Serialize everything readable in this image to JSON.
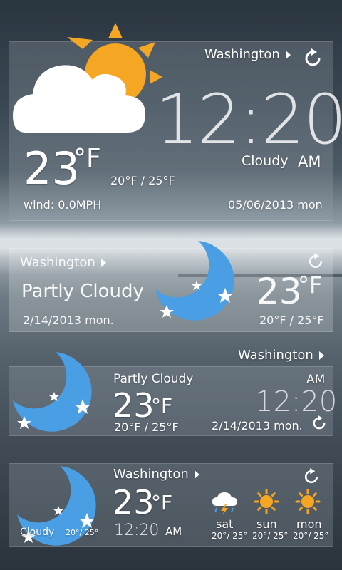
{
  "widget1": {
    "city": "Washington",
    "time": "12:20",
    "ampm": "AM",
    "condition": "Cloudy",
    "temp": "23",
    "unit": "°F",
    "range": "20°F / 25°F",
    "wind": "wind: 0.0MPH",
    "date": "05/06/2013 mon",
    "icon": "sun-behind-cloud-icon"
  },
  "widget2": {
    "city": "Washington",
    "condition": "Partly Cloudy",
    "date": "2/14/2013 mon.",
    "temp": "23",
    "unit": "°F",
    "range": "20°F / 25°F",
    "icon": "moon-stars-icon"
  },
  "widget3": {
    "city": "Washington",
    "condition": "Partly Cloudy",
    "temp": "23",
    "unit": "°F",
    "range": "20°F / 25°F",
    "ampm": "AM",
    "time": "12:20",
    "date": "2/14/2013 mon.",
    "icon": "moon-stars-icon"
  },
  "widget4": {
    "city": "Washington",
    "temp": "23",
    "unit": "°F",
    "time": "12:20",
    "ampm": "AM",
    "condition": "Cloudy",
    "range": "20°/ 25°",
    "forecast": [
      {
        "day": "sat",
        "range": "20°/ 25°",
        "icon": "thunderstorm-icon"
      },
      {
        "day": "sun",
        "range": "20°/ 25°",
        "icon": "sun-icon"
      },
      {
        "day": "mon",
        "range": "20°/ 25°",
        "icon": "sun-icon"
      }
    ]
  },
  "colors": {
    "moon": "#4a9ee3",
    "sun": "#f5a623",
    "cloud": "#ffffff"
  }
}
